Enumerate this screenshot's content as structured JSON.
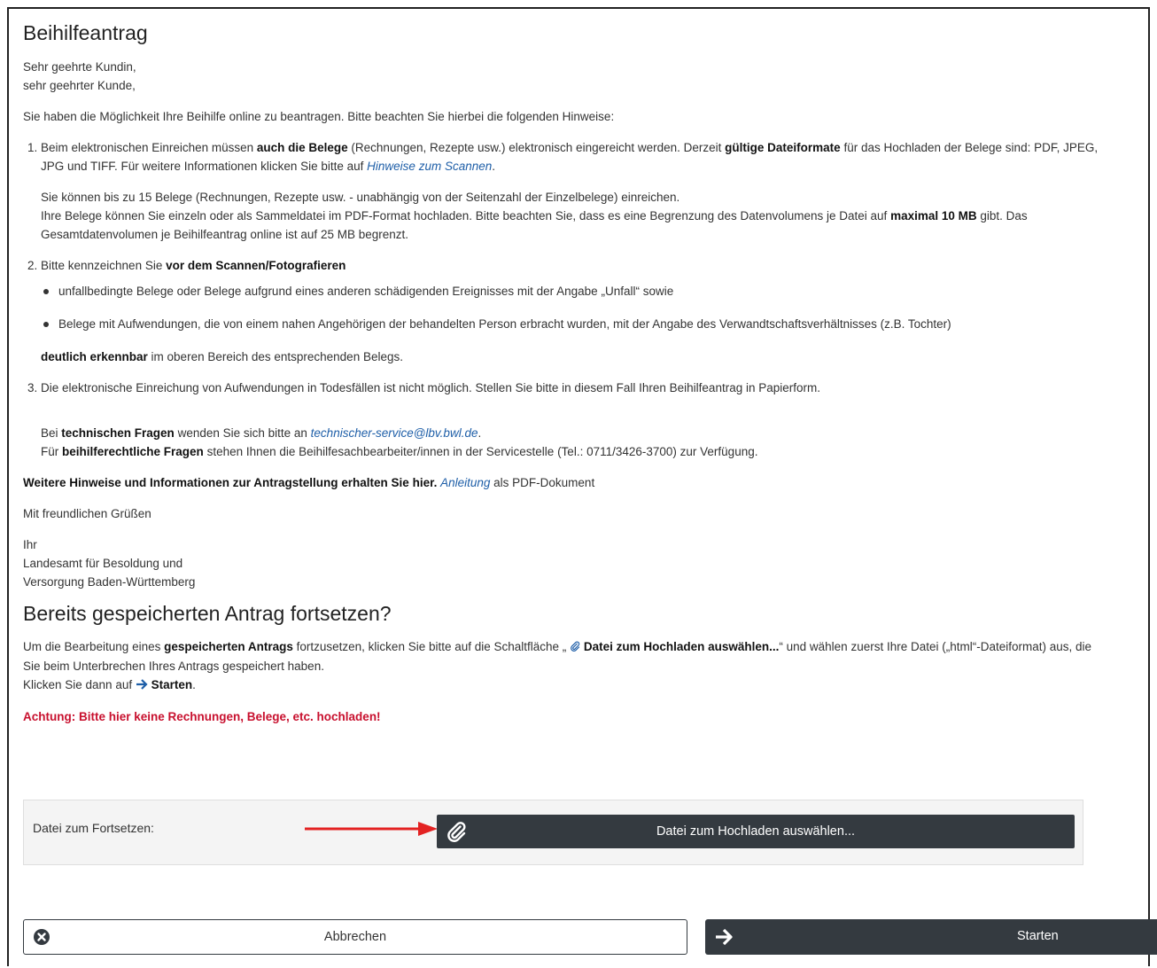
{
  "page": {
    "title": "Beihilfeantrag",
    "greeting_1": "Sehr geehrte Kundin,",
    "greeting_2": "sehr geehrter Kunde,",
    "intro": "Sie haben die Möglichkeit Ihre Beihilfe online zu beantragen. Bitte beachten Sie hierbei die folgenden Hinweise:"
  },
  "item1": {
    "t1": "Beim elektronischen Einreichen müssen ",
    "b1": "auch die Belege",
    "t2": " (Rechnungen, Rezepte usw.) elektronisch eingereicht werden. Derzeit ",
    "b2": "gültige Dateiformate",
    "t3": " für das Hochladen der Belege sind: PDF, JPEG, JPG und TIFF. Für weitere Informationen klicken Sie bitte auf ",
    "link": "Hinweise zum Scannen",
    "t4": ".",
    "p2_line1": "Sie können bis zu 15 Belege (Rechnungen, Rezepte usw. - unabhängig von der Seitenzahl der Einzelbelege) einreichen.",
    "p2_t1": "Ihre Belege können Sie einzeln oder als Sammeldatei im PDF-Format hochladen. Bitte beachten Sie, dass es eine Begrenzung des Datenvolumens je Datei auf ",
    "p2_b1": "maximal 10 MB",
    "p2_t2": " gibt. Das Gesamtdatenvolumen je Beihilfeantrag online ist auf 25 MB begrenzt."
  },
  "item2": {
    "t1": "Bitte kennzeichnen Sie ",
    "b1": "vor dem Scannen/Fotografieren",
    "bullet1": "unfallbedingte Belege oder Belege aufgrund eines anderen schädigenden Ereignisses mit der Angabe „Unfall“ sowie",
    "bullet2": "Belege mit Aufwendungen, die von einem nahen Angehörigen der behandelten Person erbracht wurden, mit der Angabe des Verwandtschaftsverhältnisses (z.B. Tochter)",
    "b2": "deutlich erkennbar",
    "t2": " im oberen Bereich des entsprechenden Belegs."
  },
  "item3": {
    "t1": "Die elektronische Einreichung von Aufwendungen in Todesfällen ist nicht möglich. Stellen Sie bitte in diesem Fall Ihren Beihilfeantrag in Papierform.",
    "q1_t1": "Bei ",
    "q1_b1": "technischen Fragen",
    "q1_t2": " wenden Sie sich bitte an ",
    "q1_link": "technischer-service@lbv.bwl.de",
    "q1_t3": ".",
    "q2_t1": "Für ",
    "q2_b1": "beihilferechtliche Fragen",
    "q2_t2": " stehen Ihnen die Beihilfesachbearbeiter/innen in der Servicestelle (Tel.: 0711/3426-3700) zur Verfügung."
  },
  "further": {
    "b1": "Weitere Hinweise und Informationen zur Antragstellung erhalten Sie hier.",
    "link": "Anleitung",
    "t1": " als PDF-Dokument"
  },
  "closing": {
    "regards": "Mit freundlichen Grüßen",
    "line1": "Ihr",
    "line2": "Landesamt für Besoldung und",
    "line3": "Versorgung Baden-Württemberg"
  },
  "resume": {
    "title": "Bereits gespeicherten Antrag fortsetzen?",
    "t1": "Um die Bearbeitung eines ",
    "b1": "gespeicherten Antrags",
    "t2": " fortzusetzen, klicken Sie bitte auf die Schaltfläche „ ",
    "b2": "Datei zum Hochladen auswählen...",
    "t3": "“ und wählen zuerst Ihre Datei („html“-Dateiformat) aus, die Sie beim Unterbrechen Ihres Antrags gespeichert haben.",
    "t4": "Klicken Sie dann auf ",
    "b3": "Starten",
    "t5": ".",
    "warning": "Achtung: Bitte hier keine Rechnungen, Belege, etc. hochladen!"
  },
  "upload": {
    "label": "Datei zum Fortsetzen:",
    "button_label": "Datei zum Hochladen auswählen..."
  },
  "actions": {
    "cancel_label": "Abbrechen",
    "start_label": "Starten"
  },
  "icons": {
    "upload": "paperclip-icon",
    "cancel": "times-circle-icon",
    "start": "arrow-right-icon",
    "annotation": "red-arrow"
  },
  "colors": {
    "button_dark": "#343a40",
    "warning": "#c8102e",
    "link": "#1f5fa8",
    "annotation_arrow": "#e32222"
  }
}
